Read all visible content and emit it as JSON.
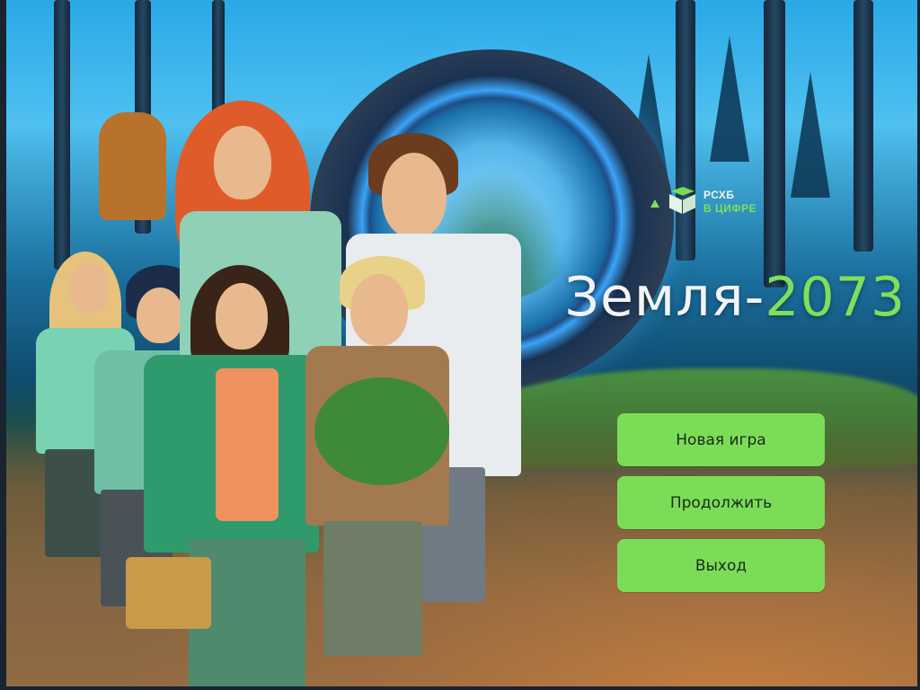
{
  "logo": {
    "line1": "РСХБ",
    "line2": "В ЦИФРЕ",
    "icon": "cube-logo-icon"
  },
  "title": {
    "main": "Земля-",
    "accent": "2073"
  },
  "menu": {
    "new_game": "Новая игра",
    "continue": "Продолжить",
    "exit": "Выход"
  },
  "colors": {
    "accent": "#7bdd57",
    "title_text": "#f2f4f7",
    "button_text": "#1b2a1b"
  }
}
